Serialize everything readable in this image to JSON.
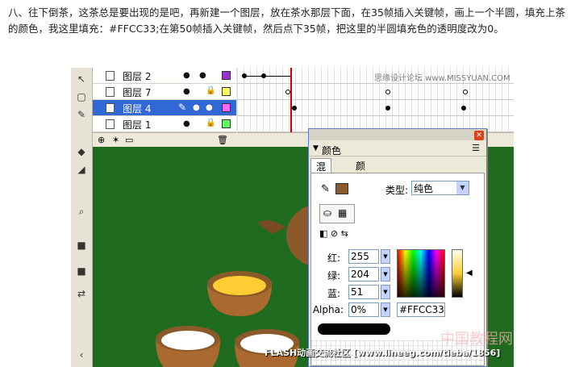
{
  "article": {
    "text": "八、往下倒茶，这茶总是要出现的是吧，再新建一个图层，放在茶水那层下面，在35帧插入关键帧，画上一个半圆，填充上茶的颜色，我这里填充：#FFCC33;在第50帧插入关键帧，然后点下35帧，把这里的半圆填充色的透明度改为0。"
  },
  "timeline": {
    "layers": [
      {
        "name": "图层 2",
        "color": "#9933cc",
        "selected": false,
        "locked": false
      },
      {
        "name": "图层 7",
        "color": "#ffff66",
        "selected": false,
        "locked": true
      },
      {
        "name": "图层 4",
        "color": "#ff66ff",
        "selected": true,
        "locked": false
      },
      {
        "name": "图层 1",
        "color": "#66ff66",
        "selected": false,
        "locked": true
      }
    ],
    "watermark": "思缘设计论坛 www.MISSYUAN.COM"
  },
  "color_panel": {
    "title": "颜色",
    "tabs": [
      "混色器",
      "颜色样本"
    ],
    "active_tab": "混色器",
    "fill_color": "#8b5a2b",
    "type_label": "类型:",
    "type_value": "纯色",
    "fields": [
      {
        "label": "红:",
        "value": "255"
      },
      {
        "label": "绿:",
        "value": "204"
      },
      {
        "label": "蓝:",
        "value": "51"
      },
      {
        "label": "Alpha:",
        "value": "0%"
      }
    ],
    "hex": "#FFCC33"
  },
  "stage": {
    "background": "#1f6b1f",
    "tea_color": "#ffcc33"
  },
  "watermarks": {
    "bottom": "FLASH动画交流社区 [www.lineeg.com/tieba/1856]",
    "cn": "中国教程网"
  }
}
